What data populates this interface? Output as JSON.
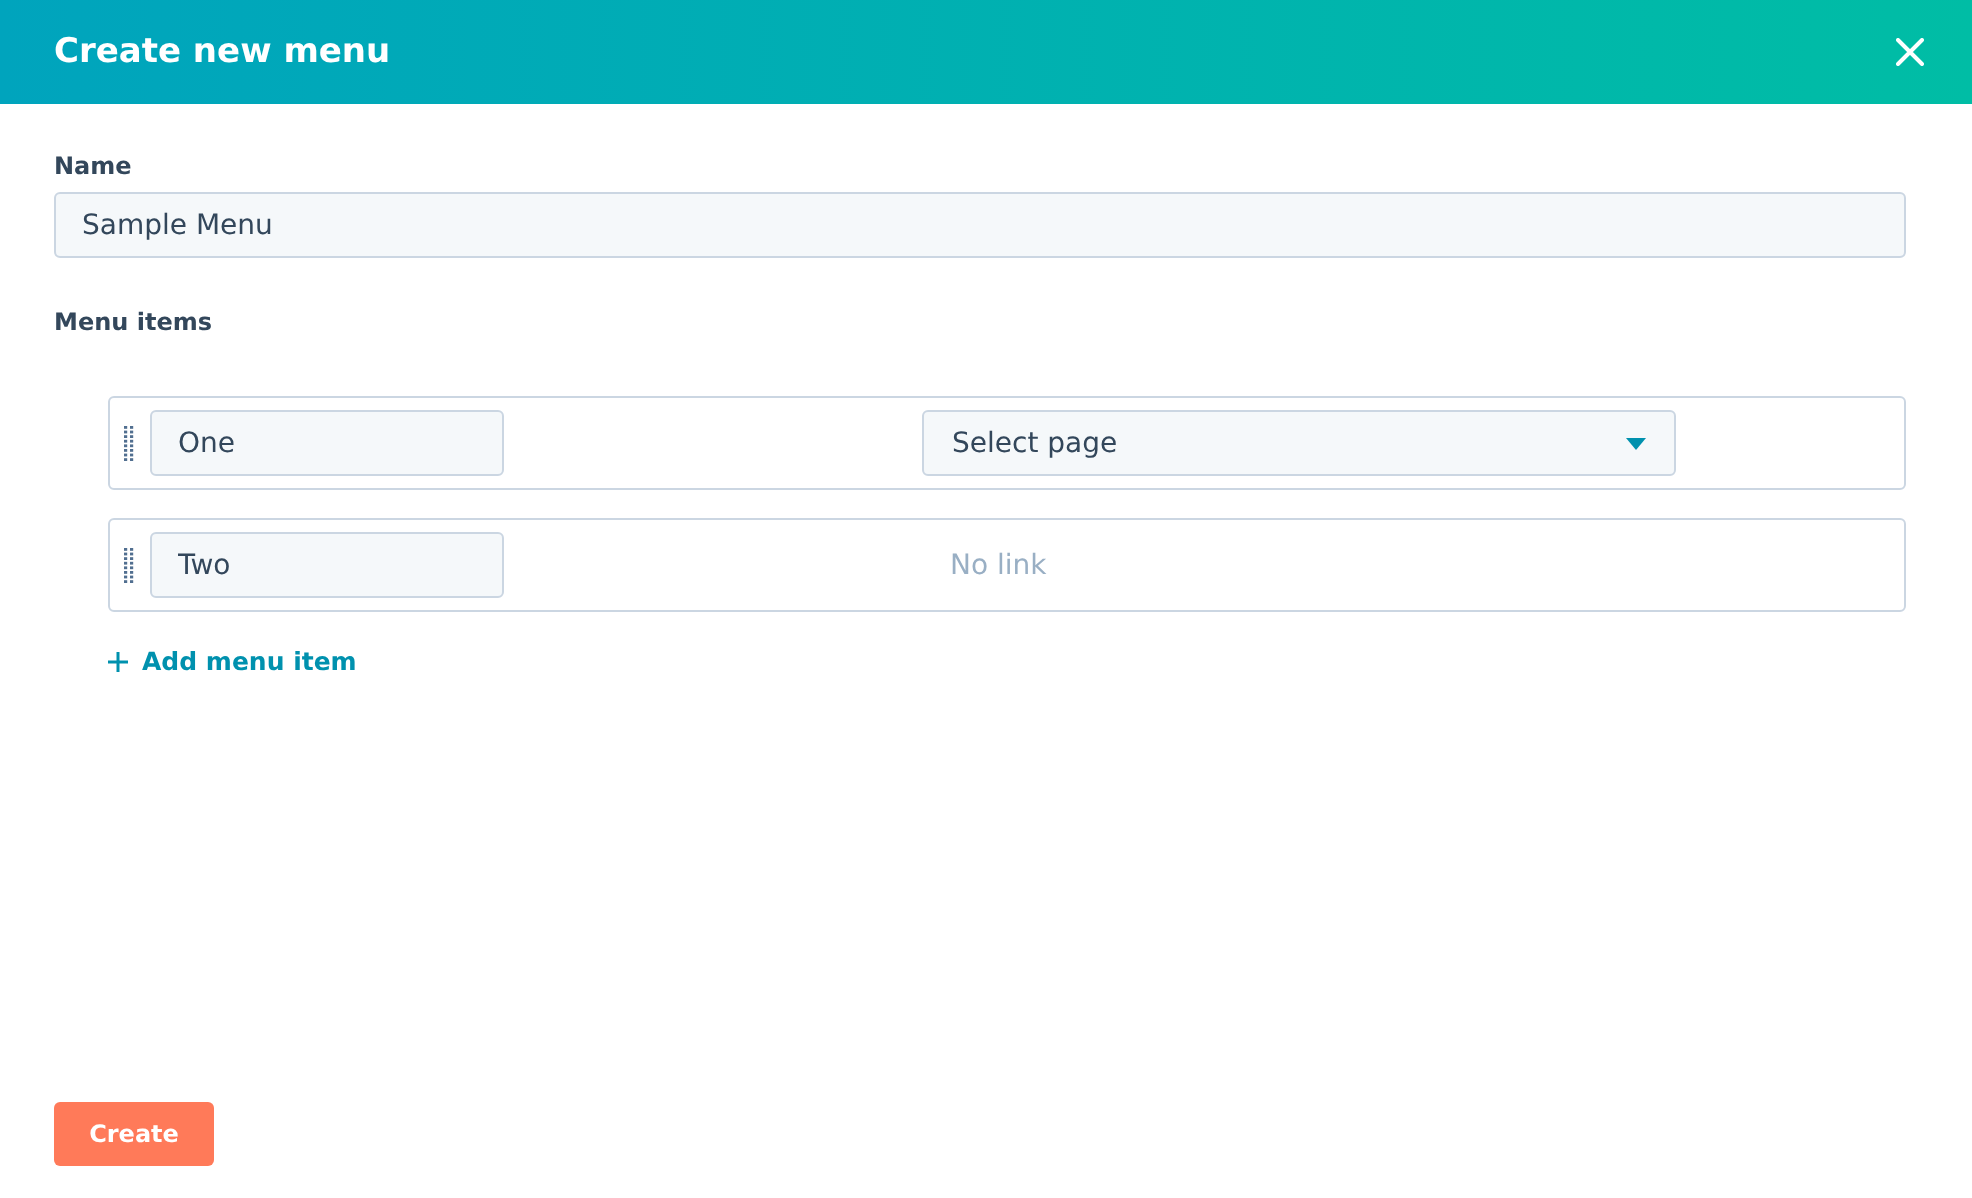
{
  "dialog": {
    "title": "Create new menu"
  },
  "name_field": {
    "label": "Name",
    "value": "Sample Menu"
  },
  "menu_items": {
    "label": "Menu items",
    "items": [
      {
        "label": "One",
        "link": {
          "kind": "select",
          "text": "Select page"
        }
      },
      {
        "label": "Two",
        "link": {
          "kind": "none",
          "text": "No link"
        }
      }
    ],
    "add_link": "Add menu item"
  },
  "buttons": {
    "create": "Create"
  }
}
